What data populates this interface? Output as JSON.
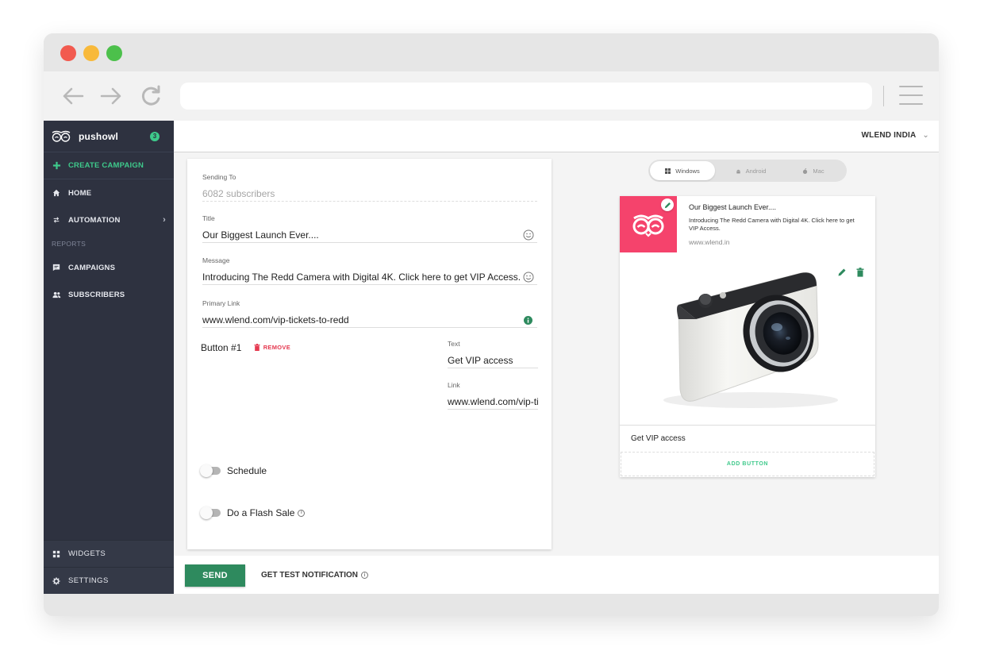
{
  "browser": {
    "url": ""
  },
  "sidebar": {
    "brand": "pushowl",
    "badge": "3",
    "create_label": "CREATE CAMPAIGN",
    "items": [
      {
        "label": "HOME",
        "icon": "home-icon"
      },
      {
        "label": "AUTOMATION",
        "icon": "automation-icon"
      }
    ],
    "reports_header": "REPORTS",
    "report_items": [
      {
        "label": "CAMPAIGNS",
        "icon": "campaigns-icon"
      },
      {
        "label": "SUBSCRIBERS",
        "icon": "subscribers-icon"
      }
    ],
    "bottom_items": [
      {
        "label": "WIDGETS",
        "icon": "widgets-icon"
      },
      {
        "label": "SETTINGS",
        "icon": "gear-icon"
      }
    ]
  },
  "topbar": {
    "account": "WLEND INDIA"
  },
  "form": {
    "sending_to_label": "Sending To",
    "sending_to_value": "6082 subscribers",
    "title_label": "Title",
    "title_value": "Our Biggest Launch Ever....",
    "message_label": "Message",
    "message_value": "Introducing The Redd Camera with Digital 4K. Click here to get VIP Access.",
    "link_label": "Primary Link",
    "link_value": "www.wlend.com/vip-tickets-to-redd",
    "button_label": "Button #1",
    "remove_label": "REMOVE",
    "button_text_label": "Text",
    "button_text_value": "Get VIP access",
    "button_link_label": "Link",
    "button_link_value": "www.wlend.com/vip-ti",
    "schedule_label": "Schedule",
    "flash_sale_label": "Do a Flash Sale"
  },
  "footer": {
    "send_label": "SEND",
    "test_label": "GET TEST NOTIFICATION"
  },
  "os_tabs": [
    {
      "label": "Windows",
      "active": true
    },
    {
      "label": "Android",
      "active": false
    },
    {
      "label": "Mac",
      "active": false
    }
  ],
  "preview": {
    "title": "Our Biggest Launch Ever....",
    "message": "Introducing The Redd Camera with Digital 4K. Click here to get VIP Access.",
    "url": "www.wlend.in",
    "button": "Get VIP access",
    "add_button": "ADD BUTTON"
  },
  "colors": {
    "accent_green": "#3ec98b",
    "send_green": "#2e8a5e",
    "sidebar_bg": "#2e3240",
    "brand_pink": "#f5436c",
    "remove_red": "#e53950"
  }
}
